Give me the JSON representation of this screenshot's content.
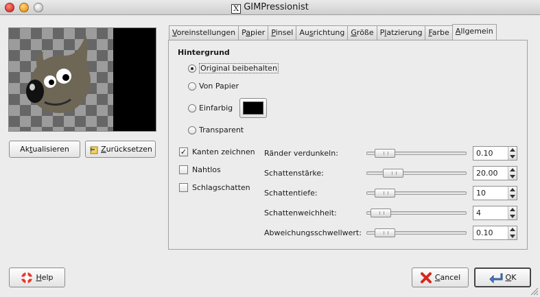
{
  "window": {
    "title": "GIMPressionist",
    "x_glyph": "X"
  },
  "left": {
    "update_button": {
      "label_pre": "Ak",
      "label_u": "t",
      "label_post": "ualisieren"
    },
    "reset_button": {
      "label_u": "Z",
      "label_post": "urücksetzen",
      "icon": "revert-icon"
    }
  },
  "tabs": [
    {
      "pre": "",
      "u": "V",
      "post": "oreinstellungen"
    },
    {
      "pre": "P",
      "u": "a",
      "post": "pier"
    },
    {
      "pre": "",
      "u": "P",
      "post": "insel"
    },
    {
      "pre": "Au",
      "u": "s",
      "post": "richtung"
    },
    {
      "pre": "",
      "u": "G",
      "post": "röße"
    },
    {
      "pre": "P",
      "u": "l",
      "post": "atzierung"
    },
    {
      "pre": "",
      "u": "F",
      "post": "arbe"
    },
    {
      "pre": "",
      "u": "A",
      "post": "llgemein"
    }
  ],
  "active_tab": 7,
  "background": {
    "heading": "Hintergrund",
    "options": [
      {
        "label": "Original beibehalten",
        "checked": true
      },
      {
        "label": "Von Papier",
        "checked": false
      },
      {
        "label": "Einfarbig",
        "checked": false
      },
      {
        "label": "Transparent",
        "checked": false
      }
    ],
    "solid_color": "#000000"
  },
  "checks": [
    {
      "label": "Kanten zeichnen",
      "checked": true
    },
    {
      "label": "Nahtlos",
      "checked": false
    },
    {
      "label": "Schlagschatten",
      "checked": false
    }
  ],
  "params": [
    {
      "label": "Ränder verdunkeln:",
      "value": "0.10",
      "level": 0.1
    },
    {
      "label": "Schattenstärke:",
      "value": "20.00",
      "level": 0.2
    },
    {
      "label": "Schattentiefe:",
      "value": "10",
      "level": 0.1
    },
    {
      "label": "Schattenweichheit:",
      "value": "4",
      "level": 0.04
    },
    {
      "label": "Abweichungsschwellwert:",
      "value": "0.10",
      "level": 0.1
    }
  ],
  "footer": {
    "help": {
      "u": "H",
      "post": "elp",
      "icon": "help-lifebuoy-icon"
    },
    "cancel": {
      "u": "C",
      "post": "ancel",
      "icon": "cancel-x-icon"
    },
    "ok": {
      "u": "O",
      "post": "K",
      "icon": "ok-return-icon"
    }
  }
}
